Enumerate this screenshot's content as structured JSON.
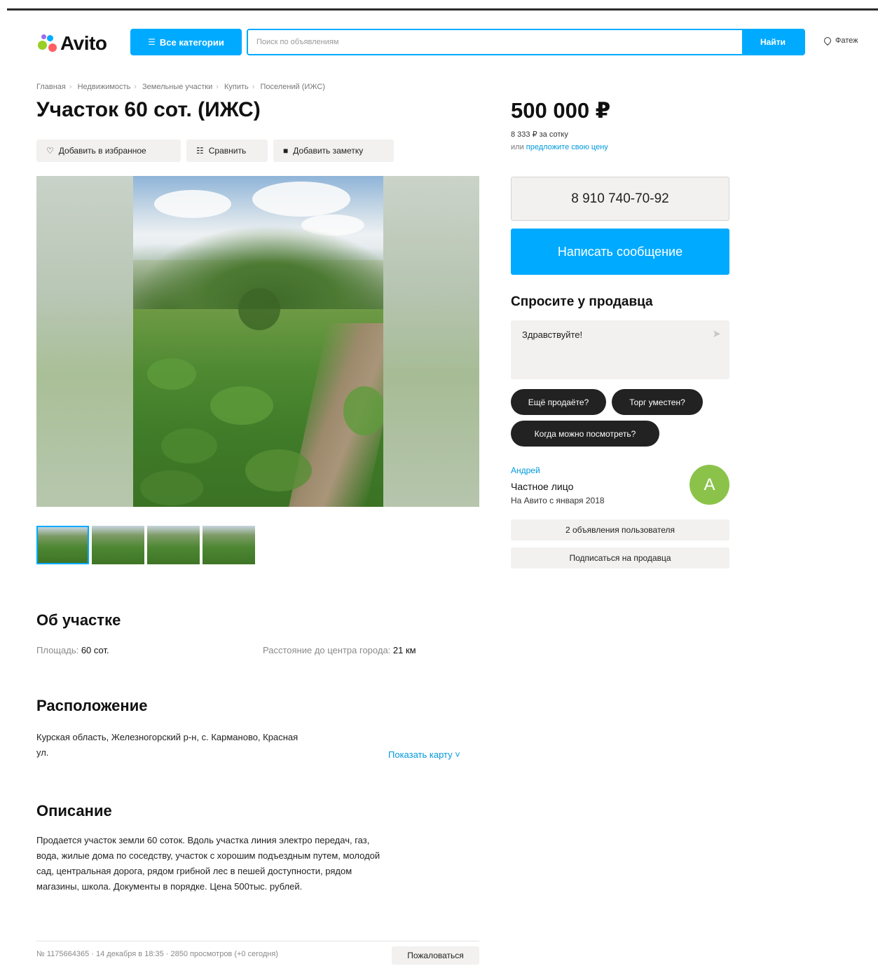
{
  "header": {
    "logo_text": "Avito",
    "categories_label": "Все категории",
    "search_placeholder": "Поиск по объявлениям",
    "search_button": "Найти",
    "city": "Фатеж",
    "colors": {
      "accent": "#00aaff"
    }
  },
  "breadcrumbs": [
    "Главная",
    "Недвижимость",
    "Земельные участки",
    "Купить",
    "Поселений (ИЖС)"
  ],
  "listing": {
    "title": "Участок 60 сот. (ИЖС)",
    "actions": {
      "favorite": "Добавить в избранное",
      "compare": "Сравнить",
      "note": "Добавить заметку"
    },
    "thumbnail_count": 4,
    "selected_thumbnail": 1
  },
  "about": {
    "heading": "Об участке",
    "area_label": "Площадь:",
    "area_value": "60 сот.",
    "distance_label": "Расстояние до центра города:",
    "distance_value": "21 км"
  },
  "location": {
    "heading": "Расположение",
    "address_line1": "Курская область, Железногорский р-н, с. Карманово, Красная",
    "address_line2": "ул.",
    "show_map": "Показать карту ˅"
  },
  "description": {
    "heading": "Описание",
    "lines": [
      "Продается участок земли 60 соток. Вдоль участка линия электро передач, газ,",
      "вода, жилые дома по соседству, участок с хорошим подъездным путем, молодой",
      "сад, центральная дорога, рядом грибной лес в пешей доступности, рядом",
      "магазины, школа. Документы в порядке. Цена 500тыс. рублей."
    ]
  },
  "footer": {
    "meta": "№ 1175664365 · 14 декабря в 18:35 · 2850 просмотров (+0 сегодня)",
    "report_button": "Пожаловаться"
  },
  "sidebar": {
    "price": "500 000 ₽",
    "price_per_unit": "8 333 ₽ за сотку",
    "offer_prefix": "или ",
    "offer_link": "предложите свою цену",
    "phone": "8 910 740-70-92",
    "message_button": "Написать сообщение",
    "ask_title": "Спросите у продавца",
    "ask_value": "Здравствуйте!",
    "chips": [
      "Ещё продаёте?",
      "Торг уместен?",
      "Когда можно посмотреть?"
    ],
    "seller": {
      "name": "Андрей",
      "type": "Частное лицо",
      "since": "На Авито с января 2018",
      "avatar_letter": "А",
      "avatar_color": "#8bc34a"
    },
    "listings_button": "2 объявления пользователя",
    "subscribe_button": "Подписаться на продавца"
  }
}
